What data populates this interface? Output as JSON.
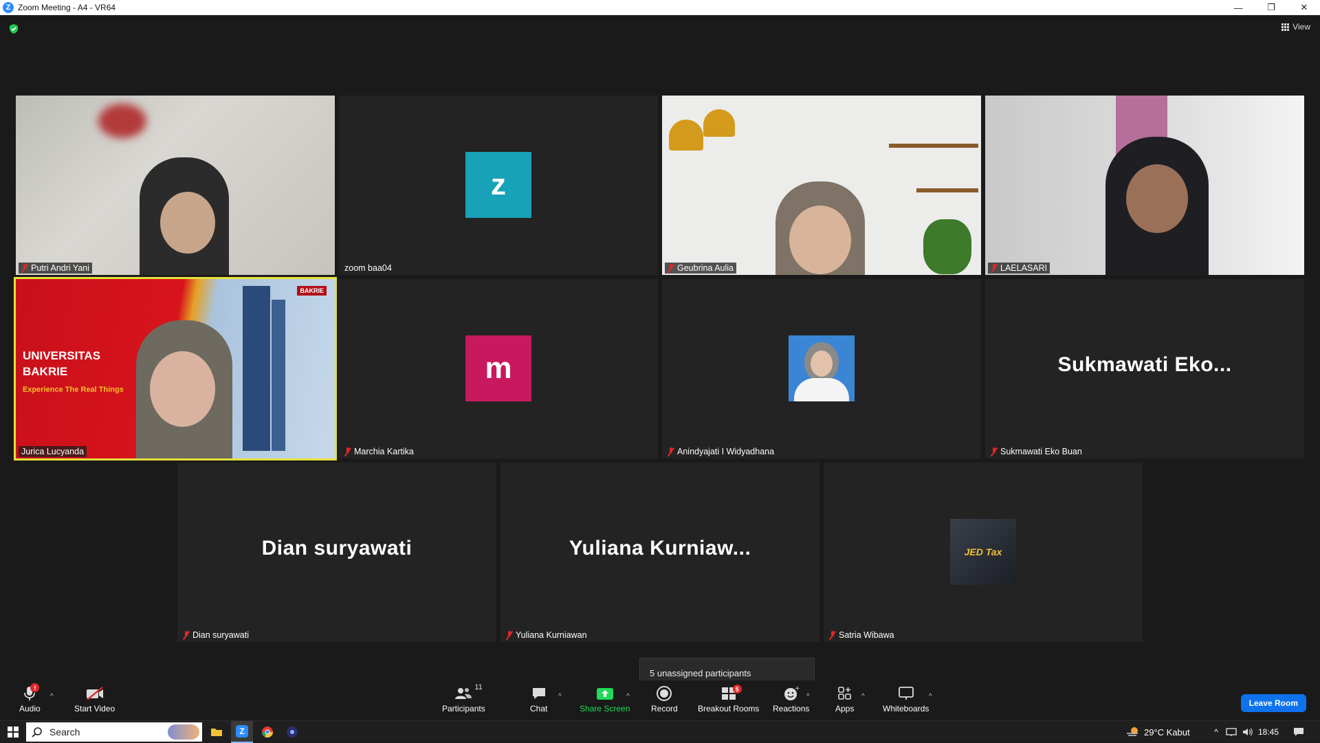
{
  "window": {
    "title": "Zoom Meeting - A4 - VR64",
    "minimize_icon": "minimize-icon",
    "restore_icon": "restore-icon",
    "close_icon": "close-icon"
  },
  "header": {
    "view_label": "View"
  },
  "tiles": [
    {
      "name": "Putri Andri Yani",
      "muted": true,
      "type": "video"
    },
    {
      "name": "zoom baa04",
      "muted": false,
      "type": "letter",
      "letter": "z",
      "color": "#17a2b8"
    },
    {
      "name": "Geubrina Aulia",
      "muted": true,
      "type": "video"
    },
    {
      "name": "LAELASARI",
      "muted": true,
      "type": "video"
    },
    {
      "name": "Jurica Lucyanda",
      "muted": false,
      "type": "video",
      "active": true,
      "banner_line1": "UNIVERSITAS",
      "banner_line2": "BAKRIE",
      "banner_tagline": "Experience The Real Things",
      "logo_text": "BAKRIE"
    },
    {
      "name": "Marchia Kartika",
      "muted": true,
      "type": "letter",
      "letter": "m",
      "color": "#c8195e"
    },
    {
      "name": "Anindyajati I Widyadhana",
      "muted": true,
      "type": "photo"
    },
    {
      "name": "Sukmawati Eko Buan",
      "muted": true,
      "type": "bigname",
      "display": "Sukmawati  Eko..."
    },
    {
      "name": "Dian suryawati",
      "muted": true,
      "type": "bigname",
      "display": "Dian suryawati"
    },
    {
      "name": "Yuliana Kurniawan",
      "muted": true,
      "type": "bigname",
      "display": "Yuliana  Kurniaw..."
    },
    {
      "name": "Satria Wibawa",
      "muted": true,
      "type": "logo",
      "logo_text": "JED Tax"
    }
  ],
  "tooltip": "5 unassigned participants",
  "toolbar": {
    "audio": "Audio",
    "start_video": "Start Video",
    "participants": "Participants",
    "participants_count": "11",
    "chat": "Chat",
    "share_screen": "Share Screen",
    "record": "Record",
    "breakout_rooms": "Breakout Rooms",
    "breakout_badge": "5",
    "reactions": "Reactions",
    "apps": "Apps",
    "whiteboards": "Whiteboards",
    "leave": "Leave Room"
  },
  "taskbar": {
    "search": "Search",
    "weather": "29°C  Kabut",
    "time": "18:45"
  },
  "colors": {
    "accent": "#0e72ed",
    "active_speaker": "#e5e13a",
    "share_green": "#23d959",
    "mute_red": "#e02828"
  }
}
